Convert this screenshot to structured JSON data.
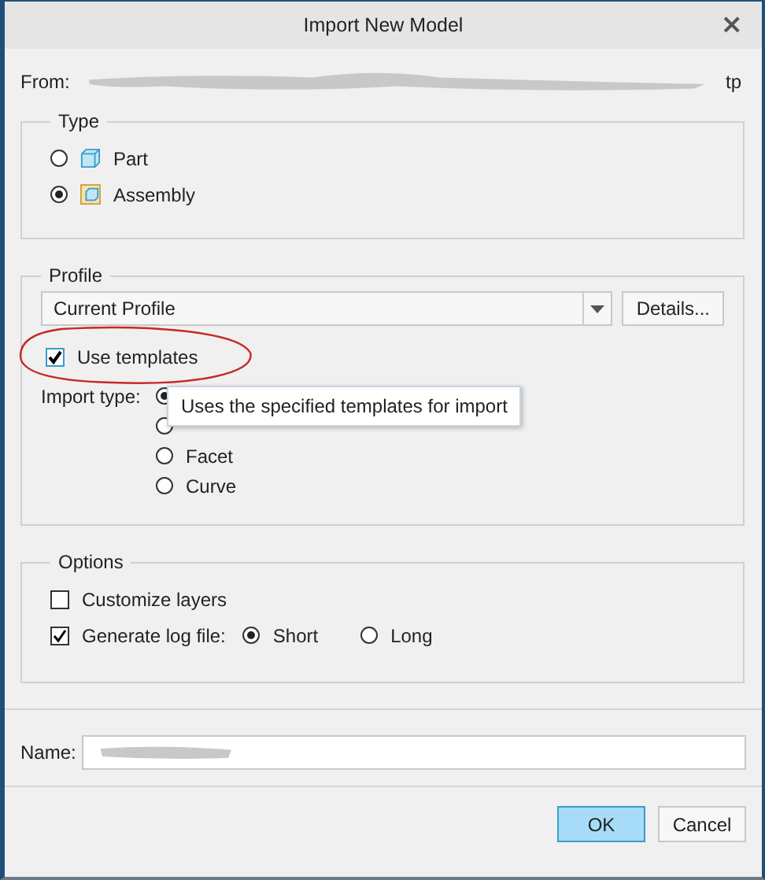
{
  "window": {
    "title": "Import New Model",
    "close": "×"
  },
  "from": {
    "label": "From:",
    "visible_end": "tp"
  },
  "type_group": {
    "title": "Type",
    "options": [
      {
        "label": "Part",
        "kind": "part",
        "selected": false
      },
      {
        "label": "Assembly",
        "kind": "assembly",
        "selected": true
      }
    ]
  },
  "profile_group": {
    "title": "Profile",
    "profile": "Current Profile",
    "details_button": "Details...",
    "use_templates": {
      "label": "Use templates",
      "checked": true
    },
    "import_type": {
      "label": "Import type:",
      "options": [
        {
          "selected": true
        },
        {
          "selected": false
        },
        {
          "label": "Facet",
          "selected": false
        },
        {
          "label": "Curve",
          "selected": false
        }
      ]
    },
    "tooltip": "Uses the specified templates for import"
  },
  "options_group": {
    "title": "Options",
    "customize_layers": {
      "label": "Customize layers",
      "checked": false
    },
    "log_file": {
      "label": "Generate log file:",
      "checked": true,
      "options": [
        {
          "label": "Short",
          "selected": true
        },
        {
          "label": "Long",
          "selected": false
        }
      ]
    }
  },
  "name": {
    "label": "Name:"
  },
  "buttons": [
    {
      "label": "OK",
      "default": true
    },
    {
      "label": "Cancel",
      "default": false
    }
  ]
}
